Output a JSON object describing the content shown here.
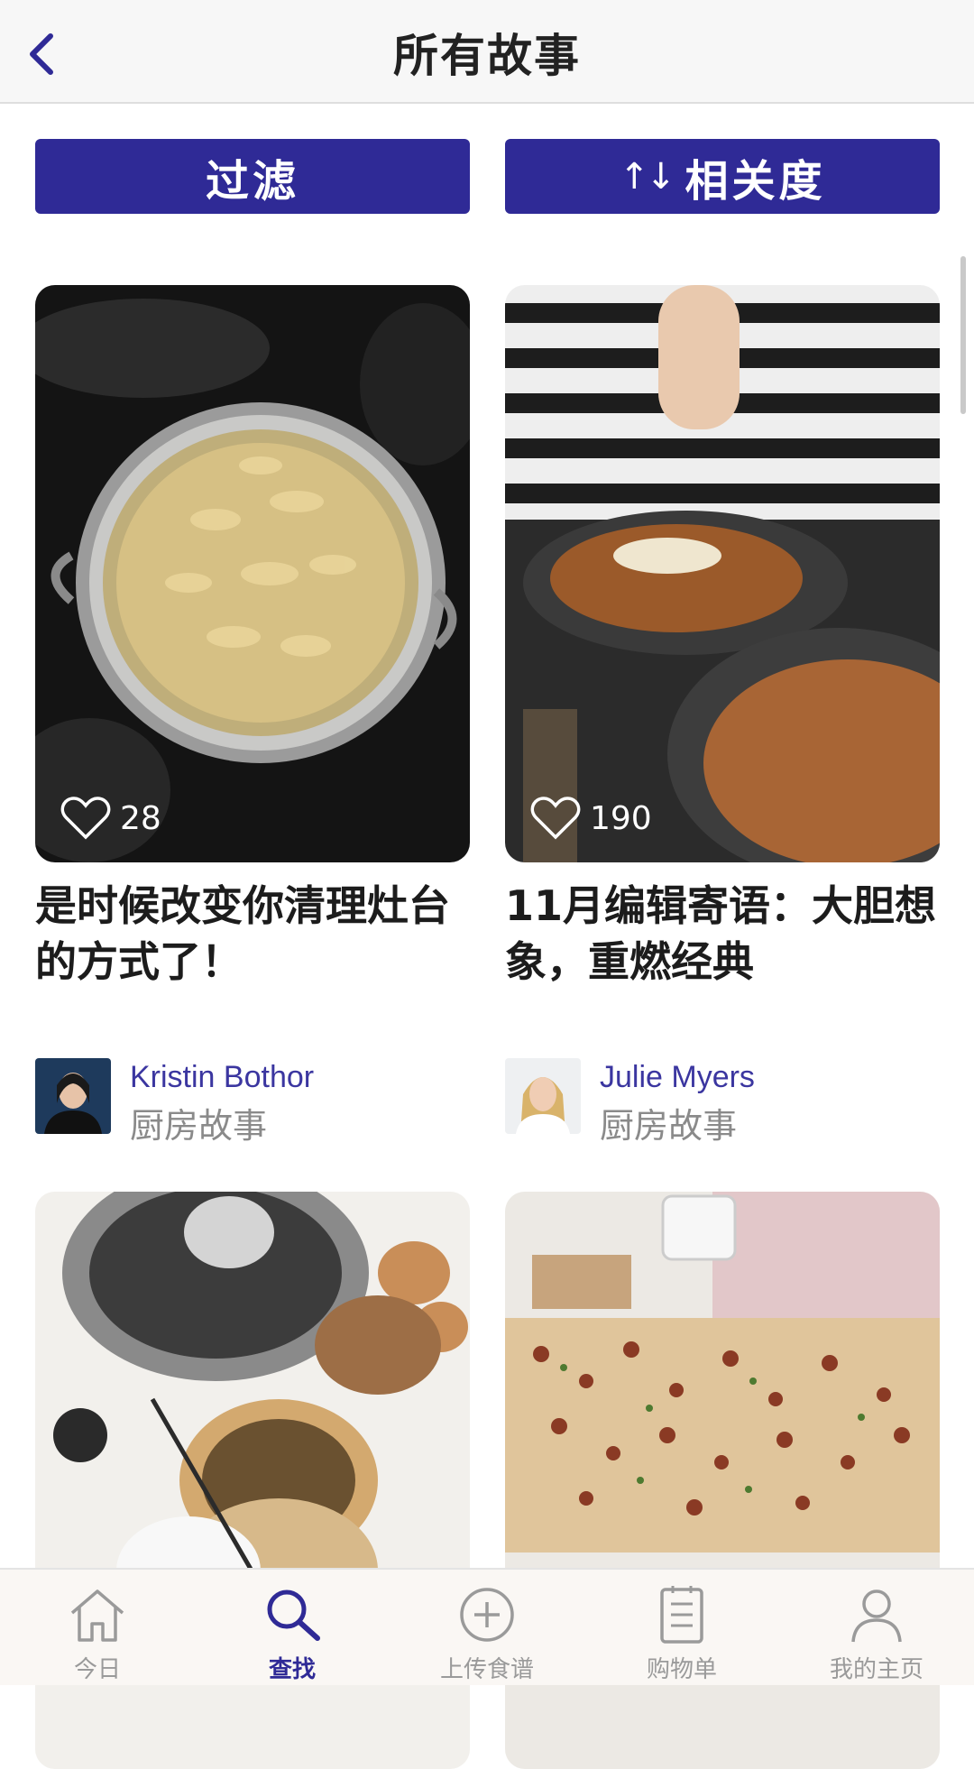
{
  "header": {
    "title": "所有故事"
  },
  "actions": {
    "filter_label": "过滤",
    "sort_label": "相关度",
    "sort_icon": "↑↓"
  },
  "stories": [
    {
      "likes": "28",
      "title": "是时候改变你清理灶台的方式了！",
      "author": "Kristin Bothor",
      "category": "厨房故事"
    },
    {
      "likes": "190",
      "title": "11月编辑寄语：大胆想象，重燃经典",
      "author": "Julie Myers",
      "category": "厨房故事"
    }
  ],
  "tabs": [
    {
      "label": "今日",
      "icon": "home-icon"
    },
    {
      "label": "查找",
      "icon": "search-icon",
      "active": true
    },
    {
      "label": "上传食谱",
      "icon": "plus-circle-icon"
    },
    {
      "label": "购物单",
      "icon": "list-icon"
    },
    {
      "label": "我的主页",
      "icon": "user-icon"
    }
  ],
  "colors": {
    "accent": "#2f2a96",
    "author": "#3b36a0",
    "muted": "#9a9a9a"
  }
}
